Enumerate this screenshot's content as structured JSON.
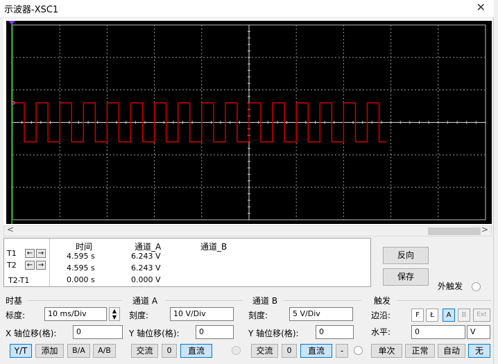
{
  "window": {
    "title": "示波器-XSC1",
    "close_icon": "close-icon"
  },
  "chart_data": {
    "type": "line",
    "title": "",
    "xlabel": "",
    "ylabel": "",
    "grid": true,
    "divisions_x": 10,
    "divisions_y": 6,
    "time_scale": "10 ms/Div",
    "volt_scale_a": "10 V/Div",
    "series": [
      {
        "name": "通道_A",
        "color": "#d40000",
        "high_div": 0.6,
        "low_div": -0.6,
        "period_div": 0.5,
        "start_div": 0.0,
        "end_div": 7.9,
        "high_first": true
      }
    ],
    "trigger_marker_color": "#7a3aff",
    "cursor_T1_color": "#00b000"
  },
  "scroll": {
    "left": "<",
    "right": ">"
  },
  "readout": {
    "headers": {
      "time": "时间",
      "cha": "通道_A",
      "chb": "通道_B"
    },
    "rows": [
      {
        "label": "T1",
        "time": "4.595 s",
        "cha": "6.243 V",
        "chb": ""
      },
      {
        "label": "T2",
        "time": "4.595 s",
        "cha": "6.243 V",
        "chb": ""
      },
      {
        "label": "T2-T1",
        "time": "0.000 s",
        "cha": "0.000 V",
        "chb": ""
      }
    ],
    "arrow_left": "←",
    "arrow_right": "→"
  },
  "right": {
    "reverse": "反向",
    "save": "保存",
    "ext_trigger": "外触发"
  },
  "timebase": {
    "title": "时基",
    "scale_label": "标度:",
    "scale_value": "10 ms/Div",
    "xpos_label": "X 轴位移(格):",
    "xpos_value": "0",
    "buttons": [
      "Y/T",
      "添加",
      "B/A",
      "A/B"
    ]
  },
  "channel_a": {
    "title": "通道 A",
    "scale_label": "刻度:",
    "scale_value": "10  V/Div",
    "ypos_label": "Y 轴位移(格):",
    "ypos_value": "0",
    "buttons": [
      "交流",
      "0",
      "直流"
    ]
  },
  "channel_b": {
    "title": "通道 B",
    "scale_label": "刻度:",
    "scale_value": "5  V/Div",
    "ypos_label": "Y 轴位移(格):",
    "ypos_value": "0",
    "buttons": [
      "交流",
      "0",
      "直流",
      "-"
    ]
  },
  "trigger": {
    "title": "触发",
    "edge_label": "边沿:",
    "edge_buttons": [
      "F",
      "Ł",
      "A",
      "B",
      "Ext"
    ],
    "level_label": "水平:",
    "level_value": "0",
    "level_unit": "V",
    "mode_buttons": [
      "单次",
      "正常",
      "自动",
      "无"
    ]
  }
}
